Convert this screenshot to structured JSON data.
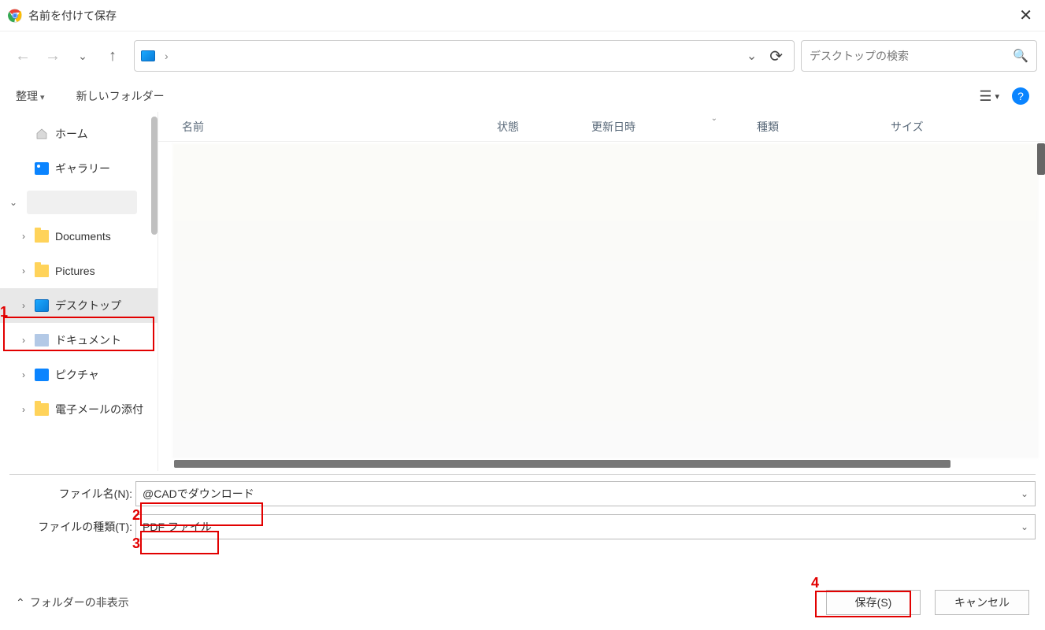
{
  "title": "名前を付けて保存",
  "nav": {
    "address_sep": "›"
  },
  "search": {
    "placeholder": "デスクトップの検索"
  },
  "toolbar": {
    "organize": "整理",
    "newfolder": "新しいフォルダー"
  },
  "sidebar": {
    "home": "ホーム",
    "gallery": "ギャラリー",
    "documents": "Documents",
    "pictures": "Pictures",
    "desktop": "デスクトップ",
    "docjp": "ドキュメント",
    "picjp": "ピクチャ",
    "mail": "電子メールの添付"
  },
  "columns": {
    "name": "名前",
    "state": "状態",
    "date": "更新日時",
    "kind": "種類",
    "size": "サイズ"
  },
  "form": {
    "filename_label": "ファイル名(N):",
    "filename_value": "@CADでダウンロード",
    "filetype_label": "ファイルの種類(T):",
    "filetype_value": "PDF ファイル"
  },
  "footer": {
    "hide": "フォルダーの非表示",
    "save": "保存(S)",
    "cancel": "キャンセル"
  },
  "annotations": {
    "n1": "1",
    "n2": "2",
    "n3": "3",
    "n4": "4"
  }
}
